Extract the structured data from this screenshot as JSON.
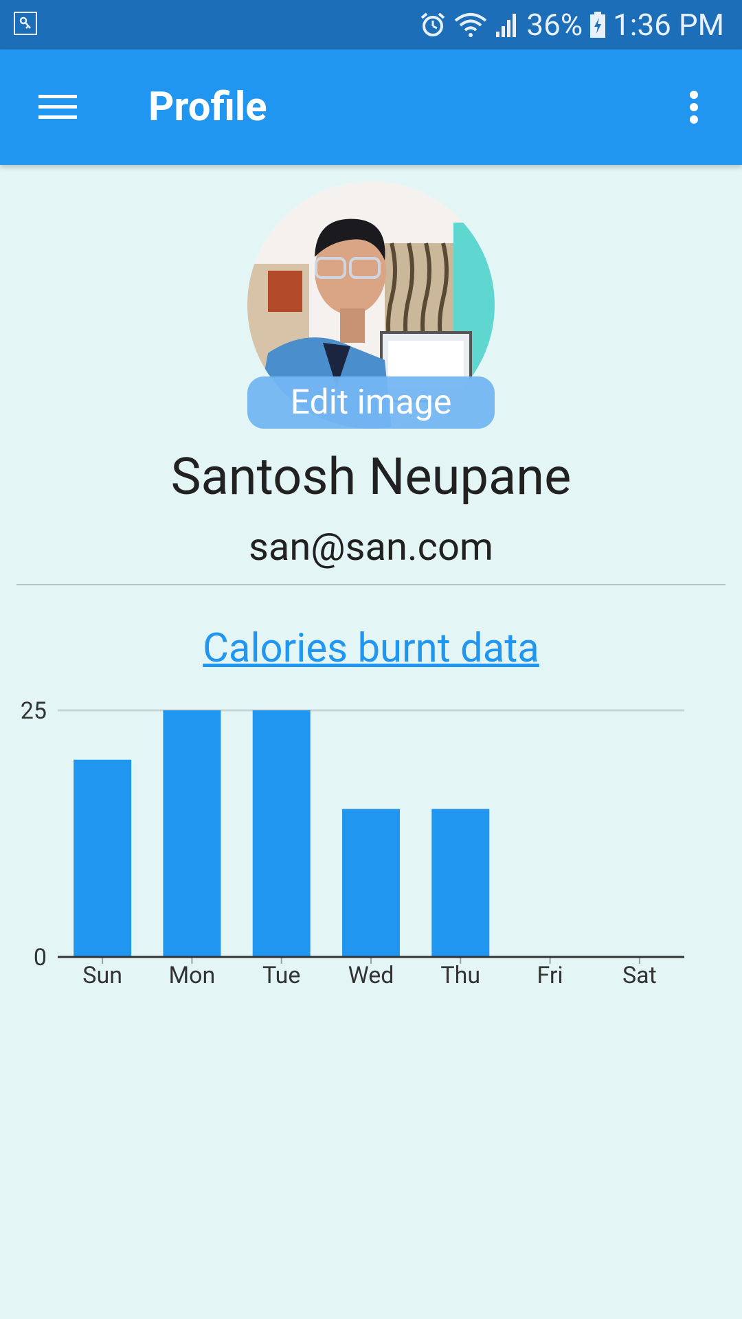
{
  "status_bar": {
    "left_icon": "key-notification-icon",
    "icons": [
      "alarm-icon",
      "wifi-icon",
      "signal-icon",
      "battery-charging-icon"
    ],
    "battery": "36%",
    "time": "1:36 PM"
  },
  "app_bar": {
    "title": "Profile",
    "menu_icon": "hamburger-menu-icon",
    "overflow_icon": "more-vert-icon",
    "color": "#2196f0"
  },
  "profile": {
    "edit_image_label": "Edit image",
    "name": "Santosh Neupane",
    "email": "san@san.com"
  },
  "chart_link": "Calories burnt data",
  "colors": {
    "status_bar": "#1c6eb9",
    "app_bar": "#2196f0",
    "background": "#e3f6f5",
    "bar": "#2196f0",
    "link": "#2196f0"
  },
  "chart_data": {
    "type": "bar",
    "categories": [
      "Sun",
      "Mon",
      "Tue",
      "Wed",
      "Thu",
      "Fri",
      "Sat"
    ],
    "values": [
      20,
      25,
      25,
      15,
      15,
      0,
      0
    ],
    "ylim": [
      0,
      25
    ],
    "yticks": [
      "0",
      "25"
    ],
    "grid": true,
    "title": "",
    "xlabel": "",
    "ylabel": ""
  }
}
